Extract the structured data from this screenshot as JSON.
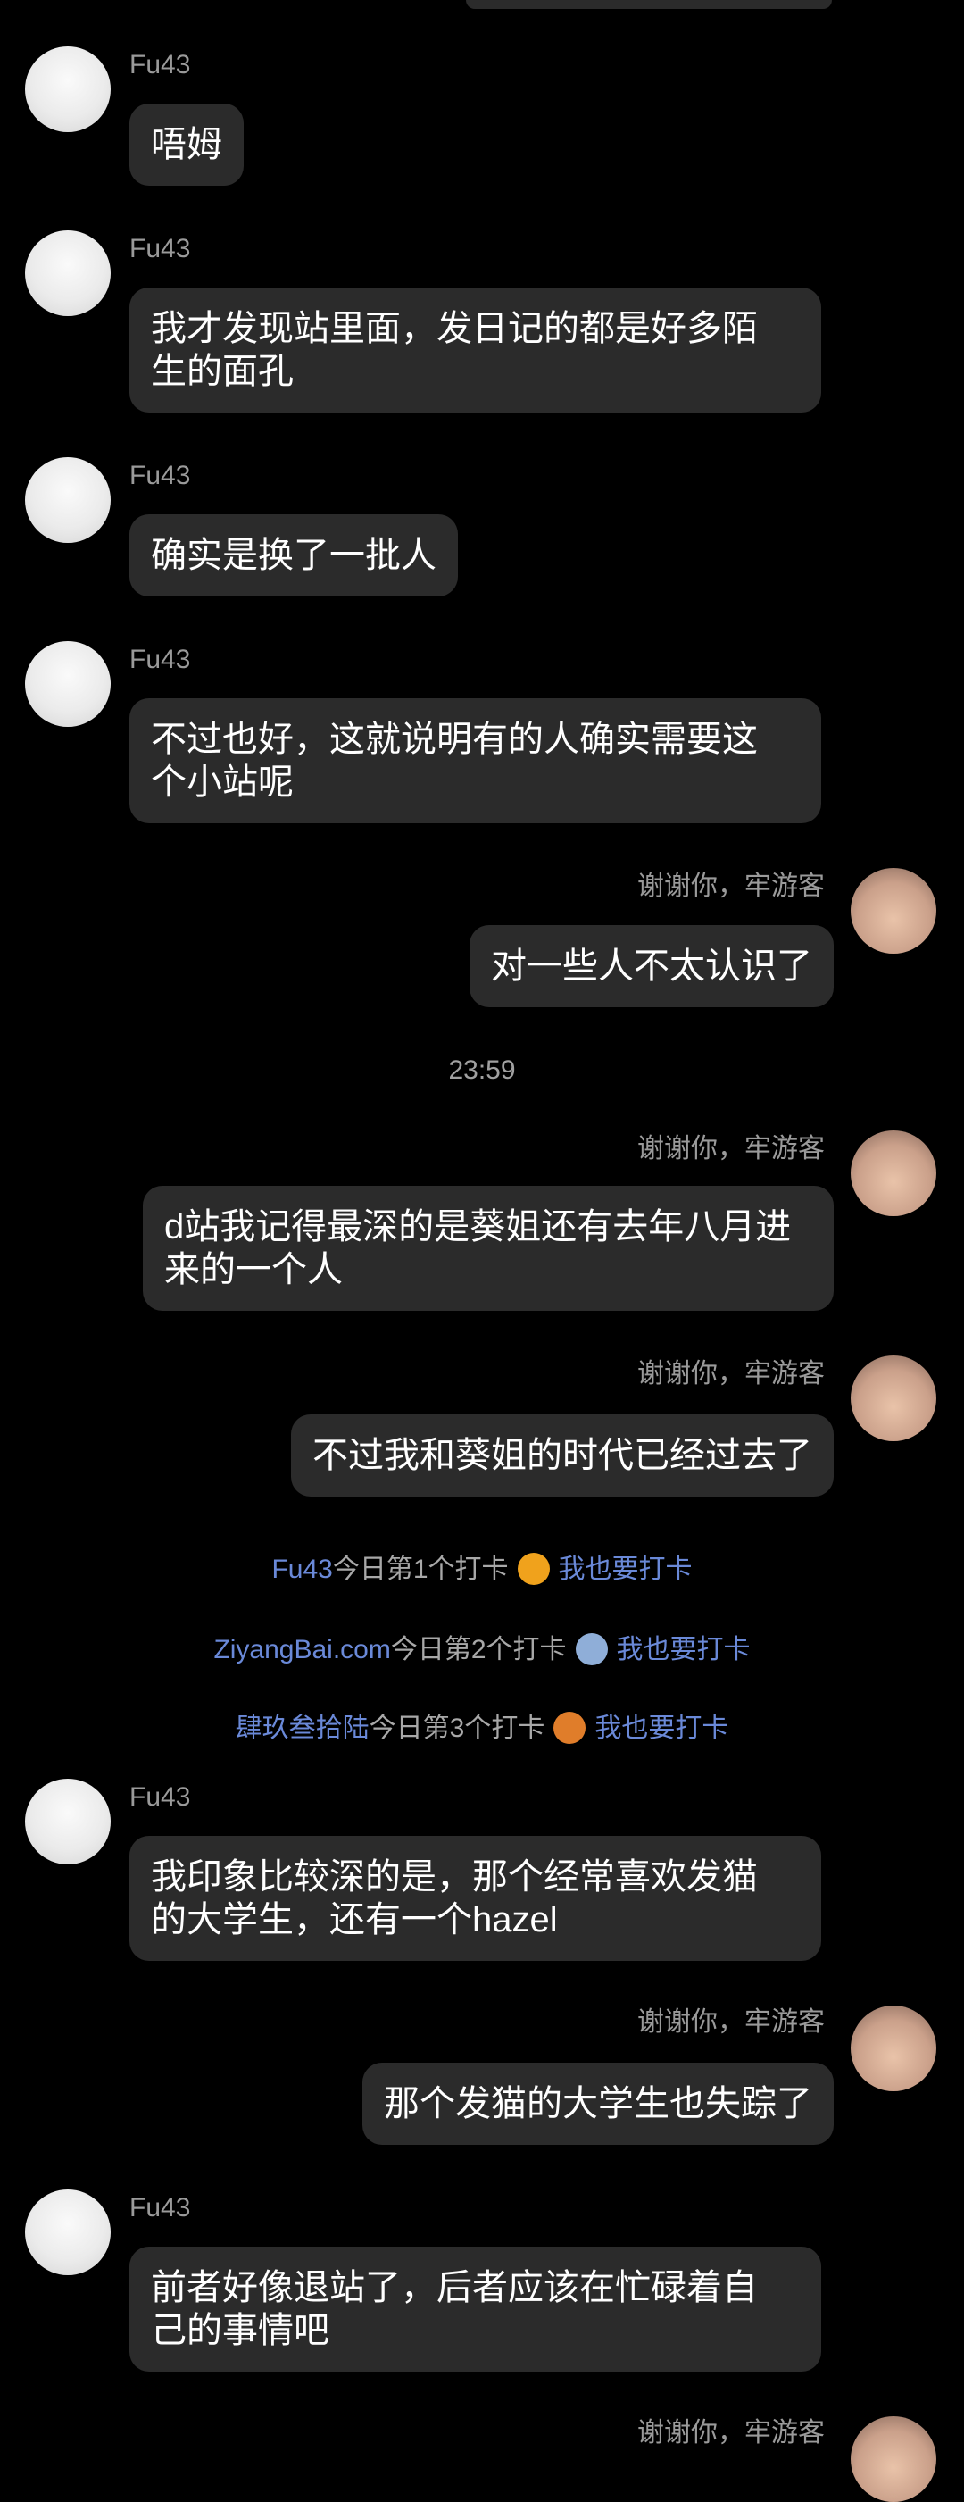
{
  "participants": {
    "left_name": "Fu43",
    "right_name": "谢谢你，牢游客"
  },
  "messages": [
    {
      "text": "唔姆"
    },
    {
      "text": "我才发现站里面，发日记的都是好多陌\n生的面孔"
    },
    {
      "text": "确实是换了一批人"
    },
    {
      "text": "不过也好，这就说明有的人确实需要这\n个小站呢"
    },
    {
      "text": "对一些人不太认识了"
    },
    {
      "text": "d站我记得最深的是葵姐还有去年八月进\n来的一个人"
    },
    {
      "text": "不过我和葵姐的时代已经过去了"
    },
    {
      "text": "我印象比较深的是，那个经常喜欢发猫\n的大学生，还有一个hazel"
    },
    {
      "text": "那个发猫的大学生也失踪了"
    },
    {
      "text": "前者好像退站了，后者应该在忙碌着自\n己的事情吧"
    }
  ],
  "timestamp": "23:59",
  "checkins": [
    {
      "user": "Fu43",
      "text": "今日第1个打卡",
      "medal": "1",
      "action": "我也要打卡"
    },
    {
      "user": "ZiyangBai.com",
      "text": "今日第2个打卡",
      "medal": "2",
      "action": "我也要打卡"
    },
    {
      "user": "肆玖叁拾陆",
      "text": "今日第3个打卡",
      "medal": "3",
      "action": "我也要打卡"
    }
  ],
  "colors": {
    "background": "#000000",
    "bubble": "#2b2b2b",
    "link": "#6a89d8",
    "medal_gold": "#f0a21c",
    "medal_silver": "#8faed8",
    "medal_bronze": "#e07d2a"
  }
}
